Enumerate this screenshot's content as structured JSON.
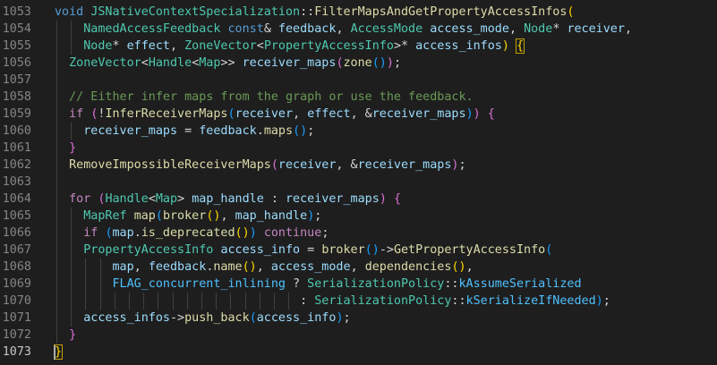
{
  "theme": {
    "background": "#1e1e1e",
    "line_number": "#858585",
    "line_number_active": "#c6c6c6",
    "indent_guide": "#404040",
    "bracket_match_border": "#c0a000",
    "colors": {
      "kw": "#569cd6",
      "ctl": "#c586c0",
      "fn": "#dcdcaa",
      "type": "#4ec9b0",
      "var": "#9cdcfe",
      "cm": "#6a9955",
      "p": "#d4d4d4",
      "b1": "#ffd700",
      "b2": "#da70d6",
      "b3": "#179fff",
      "const": "#4fc1ff"
    }
  },
  "editor": {
    "lines": [
      {
        "n": "1053",
        "g": 0,
        "t": [
          [
            "kw",
            "void "
          ],
          [
            "type",
            "JSNativeContextSpecialization"
          ],
          [
            "p",
            "::"
          ],
          [
            "fn",
            "FilterMapsAndGetPropertyAccessInfos"
          ],
          [
            "b1",
            "("
          ]
        ]
      },
      {
        "n": "1054",
        "g": 2,
        "t": [
          [
            "p",
            "    "
          ],
          [
            "type",
            "NamedAccessFeedback"
          ],
          [
            "p",
            " "
          ],
          [
            "kw",
            "const"
          ],
          [
            "p",
            "& "
          ],
          [
            "var",
            "feedback"
          ],
          [
            "p",
            ", "
          ],
          [
            "type",
            "AccessMode"
          ],
          [
            "p",
            " "
          ],
          [
            "var",
            "access_mode"
          ],
          [
            "p",
            ", "
          ],
          [
            "type",
            "Node"
          ],
          [
            "p",
            "* "
          ],
          [
            "var",
            "receiver"
          ],
          [
            "p",
            ","
          ]
        ]
      },
      {
        "n": "1055",
        "g": 2,
        "t": [
          [
            "p",
            "    "
          ],
          [
            "type",
            "Node"
          ],
          [
            "p",
            "* "
          ],
          [
            "var",
            "effect"
          ],
          [
            "p",
            ", "
          ],
          [
            "type",
            "ZoneVector"
          ],
          [
            "p",
            "<"
          ],
          [
            "type",
            "PropertyAccessInfo"
          ],
          [
            "p",
            ">* "
          ],
          [
            "var",
            "access_infos"
          ],
          [
            "b1",
            ")"
          ],
          [
            "p",
            " "
          ],
          [
            "b1",
            "{",
            "match"
          ]
        ]
      },
      {
        "n": "1056",
        "g": 1,
        "t": [
          [
            "p",
            "  "
          ],
          [
            "type",
            "ZoneVector"
          ],
          [
            "p",
            "<"
          ],
          [
            "type",
            "Handle"
          ],
          [
            "p",
            "<"
          ],
          [
            "type",
            "Map"
          ],
          [
            "p",
            ">> "
          ],
          [
            "var",
            "receiver_maps"
          ],
          [
            "b2",
            "("
          ],
          [
            "fn",
            "zone"
          ],
          [
            "b3",
            "()"
          ],
          [
            "b2",
            ")"
          ],
          [
            "p",
            ";"
          ]
        ]
      },
      {
        "n": "1057",
        "g": 1,
        "t": []
      },
      {
        "n": "1058",
        "g": 1,
        "t": [
          [
            "p",
            "  "
          ],
          [
            "cm",
            "// Either infer maps from the graph or use the feedback."
          ]
        ]
      },
      {
        "n": "1059",
        "g": 1,
        "t": [
          [
            "p",
            "  "
          ],
          [
            "ctl",
            "if"
          ],
          [
            "p",
            " "
          ],
          [
            "b2",
            "("
          ],
          [
            "p",
            "!"
          ],
          [
            "fn",
            "InferReceiverMaps"
          ],
          [
            "b3",
            "("
          ],
          [
            "var",
            "receiver"
          ],
          [
            "p",
            ", "
          ],
          [
            "var",
            "effect"
          ],
          [
            "p",
            ", &"
          ],
          [
            "var",
            "receiver_maps"
          ],
          [
            "b3",
            ")"
          ],
          [
            "b2",
            ")"
          ],
          [
            "p",
            " "
          ],
          [
            "b2",
            "{"
          ]
        ]
      },
      {
        "n": "1060",
        "g": 2,
        "t": [
          [
            "p",
            "    "
          ],
          [
            "var",
            "receiver_maps"
          ],
          [
            "p",
            " = "
          ],
          [
            "var",
            "feedback"
          ],
          [
            "p",
            "."
          ],
          [
            "fn",
            "maps"
          ],
          [
            "b3",
            "()"
          ],
          [
            "p",
            ";"
          ]
        ]
      },
      {
        "n": "1061",
        "g": 1,
        "t": [
          [
            "p",
            "  "
          ],
          [
            "b2",
            "}"
          ]
        ]
      },
      {
        "n": "1062",
        "g": 1,
        "t": [
          [
            "p",
            "  "
          ],
          [
            "fn",
            "RemoveImpossibleReceiverMaps"
          ],
          [
            "b2",
            "("
          ],
          [
            "var",
            "receiver"
          ],
          [
            "p",
            ", &"
          ],
          [
            "var",
            "receiver_maps"
          ],
          [
            "b2",
            ")"
          ],
          [
            "p",
            ";"
          ]
        ]
      },
      {
        "n": "1063",
        "g": 1,
        "t": []
      },
      {
        "n": "1064",
        "g": 1,
        "t": [
          [
            "p",
            "  "
          ],
          [
            "ctl",
            "for"
          ],
          [
            "p",
            " "
          ],
          [
            "b2",
            "("
          ],
          [
            "type",
            "Handle"
          ],
          [
            "p",
            "<"
          ],
          [
            "type",
            "Map"
          ],
          [
            "p",
            "> "
          ],
          [
            "var",
            "map_handle"
          ],
          [
            "p",
            " : "
          ],
          [
            "var",
            "receiver_maps"
          ],
          [
            "b2",
            ")"
          ],
          [
            "p",
            " "
          ],
          [
            "b2",
            "{"
          ]
        ]
      },
      {
        "n": "1065",
        "g": 2,
        "t": [
          [
            "p",
            "    "
          ],
          [
            "type",
            "MapRef"
          ],
          [
            "p",
            " "
          ],
          [
            "fn",
            "map"
          ],
          [
            "b3",
            "("
          ],
          [
            "fn",
            "broker"
          ],
          [
            "b1",
            "()"
          ],
          [
            "p",
            ", "
          ],
          [
            "var",
            "map_handle"
          ],
          [
            "b3",
            ")"
          ],
          [
            "p",
            ";"
          ]
        ]
      },
      {
        "n": "1066",
        "g": 2,
        "t": [
          [
            "p",
            "    "
          ],
          [
            "ctl",
            "if"
          ],
          [
            "p",
            " "
          ],
          [
            "b3",
            "("
          ],
          [
            "var",
            "map"
          ],
          [
            "p",
            "."
          ],
          [
            "fn",
            "is_deprecated"
          ],
          [
            "b1",
            "()"
          ],
          [
            "b3",
            ")"
          ],
          [
            "p",
            " "
          ],
          [
            "ctl",
            "continue"
          ],
          [
            "p",
            ";"
          ]
        ]
      },
      {
        "n": "1067",
        "g": 2,
        "t": [
          [
            "p",
            "    "
          ],
          [
            "type",
            "PropertyAccessInfo"
          ],
          [
            "p",
            " "
          ],
          [
            "var",
            "access_info"
          ],
          [
            "p",
            " = "
          ],
          [
            "fn",
            "broker"
          ],
          [
            "b3",
            "()"
          ],
          [
            "p",
            "->"
          ],
          [
            "fn",
            "GetPropertyAccessInfo"
          ],
          [
            "b3",
            "("
          ]
        ]
      },
      {
        "n": "1068",
        "g": 4,
        "t": [
          [
            "p",
            "        "
          ],
          [
            "var",
            "map"
          ],
          [
            "p",
            ", "
          ],
          [
            "var",
            "feedback"
          ],
          [
            "p",
            "."
          ],
          [
            "fn",
            "name"
          ],
          [
            "b1",
            "()"
          ],
          [
            "p",
            ", "
          ],
          [
            "var",
            "access_mode"
          ],
          [
            "p",
            ", "
          ],
          [
            "fn",
            "dependencies"
          ],
          [
            "b1",
            "()"
          ],
          [
            "p",
            ","
          ]
        ]
      },
      {
        "n": "1069",
        "g": 4,
        "t": [
          [
            "p",
            "        "
          ],
          [
            "const",
            "FLAG_concurrent_inlining"
          ],
          [
            "p",
            " ? "
          ],
          [
            "type",
            "SerializationPolicy"
          ],
          [
            "p",
            "::"
          ],
          [
            "const",
            "kAssumeSerialized"
          ]
        ]
      },
      {
        "n": "1070",
        "g": 17,
        "t": [
          [
            "p",
            "                                  : "
          ],
          [
            "type",
            "SerializationPolicy"
          ],
          [
            "p",
            "::"
          ],
          [
            "const",
            "kSerializeIfNeeded"
          ],
          [
            "b3",
            ")"
          ],
          [
            "p",
            ";"
          ]
        ]
      },
      {
        "n": "1071",
        "g": 2,
        "t": [
          [
            "p",
            "    "
          ],
          [
            "var",
            "access_infos"
          ],
          [
            "p",
            "->"
          ],
          [
            "fn",
            "push_back"
          ],
          [
            "b3",
            "("
          ],
          [
            "var",
            "access_info"
          ],
          [
            "b3",
            ")"
          ],
          [
            "p",
            ";"
          ]
        ]
      },
      {
        "n": "1072",
        "g": 1,
        "t": [
          [
            "p",
            "  "
          ],
          [
            "b2",
            "}"
          ]
        ]
      },
      {
        "n": "1073",
        "g": 0,
        "active": true,
        "caret": true,
        "t": [
          [
            "b1",
            "}",
            "match"
          ]
        ]
      }
    ]
  }
}
